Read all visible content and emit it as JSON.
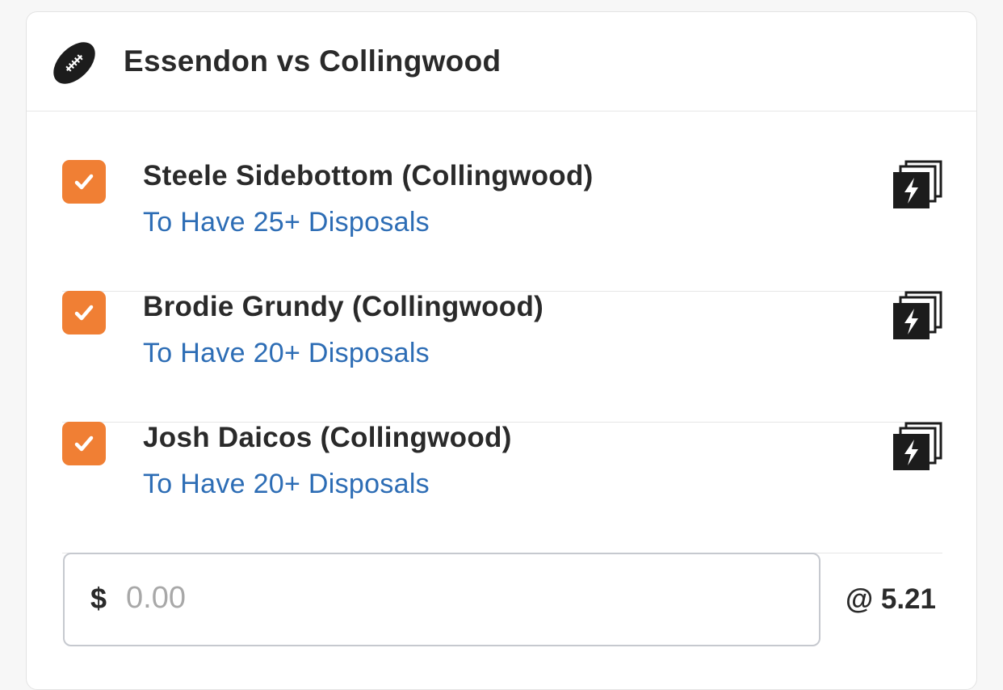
{
  "match": {
    "title": "Essendon vs Collingwood",
    "sport_icon": "football-icon"
  },
  "selections": [
    {
      "player": "Steele Sidebottom (Collingwood)",
      "market": "To Have 25+ Disposals",
      "checked": true,
      "action_icon": "same-game-multi-icon"
    },
    {
      "player": "Brodie Grundy (Collingwood)",
      "market": "To Have 20+ Disposals",
      "checked": true,
      "action_icon": "same-game-multi-icon"
    },
    {
      "player": "Josh Daicos (Collingwood)",
      "market": "To Have 20+ Disposals",
      "checked": true,
      "action_icon": "same-game-multi-icon"
    }
  ],
  "stake": {
    "currency": "$",
    "placeholder": "0.00",
    "value": ""
  },
  "odds_label": "@ 5.21",
  "colors": {
    "accent": "#f07f34",
    "link": "#2d6db5",
    "text": "#2a2a2a"
  }
}
